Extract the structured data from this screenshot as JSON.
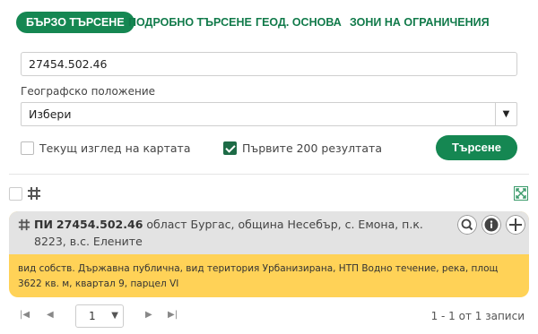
{
  "tabs": [
    {
      "label": "БЪРЗО ТЪРСЕНЕ",
      "active": true
    },
    {
      "label": "ПОДРОБНО ТЪРСЕНЕ",
      "active": false
    },
    {
      "label": "ГЕОД. ОСНОВА",
      "active": false
    },
    {
      "label": "ЗОНИ НА ОГРАНИЧЕНИЯ",
      "active": false
    }
  ],
  "search": {
    "value": "27454.502.46"
  },
  "location": {
    "label": "Географско положение",
    "selected": "Избери"
  },
  "options": {
    "current_view_label": "Текущ изглед на картата",
    "current_view_checked": false,
    "first200_label": "Първите 200 резултата",
    "first200_checked": true
  },
  "search_button": "Търсене",
  "result": {
    "id_prefix": "ПИ",
    "id": "27454.502.46",
    "address": "област Бургас, община Несебър, с. Емона, п.к. 8223, в.с. Елените",
    "details": "вид собств. Държавна публична, вид територия Урбанизирана, НТП Водно течение, река, площ 3622 кв. м, квартал 9, парцел VI"
  },
  "pager": {
    "page": "1",
    "info": "1 - 1 от 1 записи"
  },
  "colors": {
    "accent": "#158752",
    "result_body": "#ffd257",
    "result_head": "#e3e3e3"
  }
}
